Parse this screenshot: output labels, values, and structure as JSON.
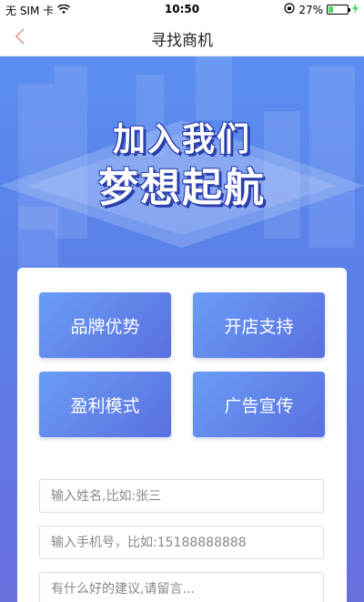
{
  "status_bar": {
    "carrier": "无 SIM 卡",
    "time": "10:50",
    "battery": "27%",
    "battery_level": 0.27
  },
  "nav": {
    "title": "寻找商机",
    "back_icon": "chevron-left-icon"
  },
  "banner": {
    "line1": "加入我们",
    "line2": "梦想起航"
  },
  "tiles": [
    {
      "label": "品牌优势"
    },
    {
      "label": "开店支持"
    },
    {
      "label": "盈利模式"
    },
    {
      "label": "广告宣传"
    }
  ],
  "form": {
    "name_placeholder": "输入姓名,比如:张三",
    "phone_placeholder": "输入手机号，比如:15188888888",
    "message_placeholder": "有什么好的建议,请留言..."
  },
  "colors": {
    "accent": "#5a7fe8",
    "tile_start": "#6a9df5",
    "tile_end": "#5a6fe0",
    "battery_fill": "#4cd964"
  }
}
